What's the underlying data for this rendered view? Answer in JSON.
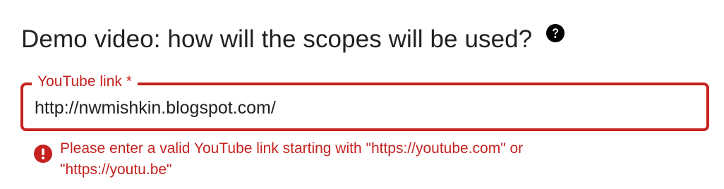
{
  "section": {
    "title": "Demo video: how will the scopes will be used?",
    "help_icon": "help-circle-icon"
  },
  "youtube_field": {
    "label": "YouTube link *",
    "value": "http://nwmishkin.blogspot.com/",
    "state": "error"
  },
  "error": {
    "icon": "error-circle-icon",
    "message": "Please enter a valid YouTube link starting with \"https://youtube.com\" or \"https://youtu.be\""
  },
  "colors": {
    "error": "#c5221f",
    "text": "#202124",
    "help_icon": "#000000"
  }
}
